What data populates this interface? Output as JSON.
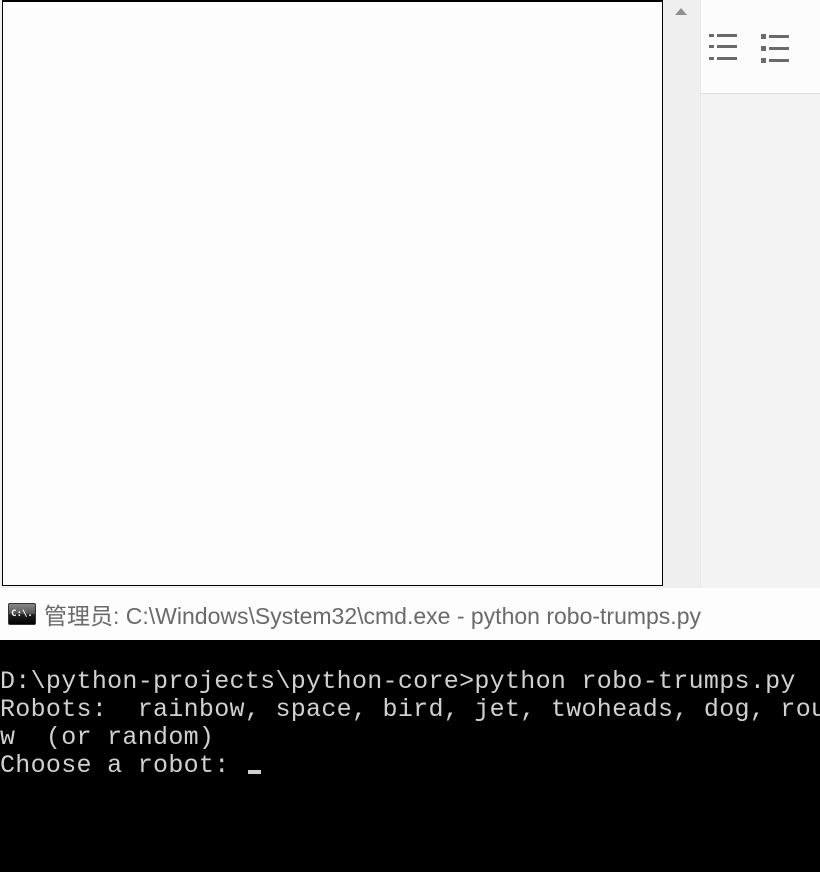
{
  "titlebar": {
    "icon_label": "C:\\.",
    "title": "管理员: C:\\Windows\\System32\\cmd.exe - python  robo-trumps.py"
  },
  "terminal": {
    "line1": "D:\\python-projects\\python-core>python robo-trumps.py",
    "line2": "Robots:  rainbow, space, bird, jet, twoheads, dog, round, b",
    "line3": "w  (or random)",
    "line4": "Choose a robot: "
  }
}
